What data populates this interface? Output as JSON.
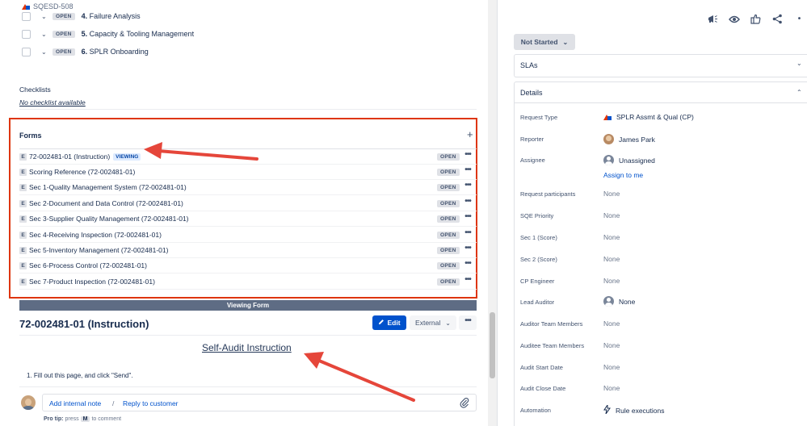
{
  "issue": {
    "key": "SQESD-508"
  },
  "subtasks": [
    {
      "status": "OPEN",
      "number": "4.",
      "title": "Failure Analysis"
    },
    {
      "status": "OPEN",
      "number": "5.",
      "title": "Capacity & Tooling Management"
    },
    {
      "status": "OPEN",
      "number": "6.",
      "title": "SPLR Onboarding"
    }
  ],
  "checklists": {
    "label": "Checklists",
    "empty": "No checklist available"
  },
  "forms": {
    "title": "Forms",
    "add": "+",
    "badge_letter": "E",
    "viewing_label": "VIEWING",
    "rows": [
      {
        "name": "72-002481-01 (Instruction)",
        "status": "OPEN"
      },
      {
        "name": "Scoring Reference (72-002481-01)",
        "status": "OPEN"
      },
      {
        "name": "Sec 1-Quality Management System (72-002481-01)",
        "status": "OPEN"
      },
      {
        "name": "Sec 2-Document and Data Control (72-002481-01)",
        "status": "OPEN"
      },
      {
        "name": "Sec 3-Supplier Quality Management (72-002481-01)",
        "status": "OPEN"
      },
      {
        "name": "Sec 4-Receiving Inspection (72-002481-01)",
        "status": "OPEN"
      },
      {
        "name": "Sec 5-Inventory Management (72-002481-01)",
        "status": "OPEN"
      },
      {
        "name": "Sec 6-Process Control (72-002481-01)",
        "status": "OPEN"
      },
      {
        "name": "Sec 7-Product Inspection (72-002481-01)",
        "status": "OPEN"
      }
    ],
    "more": "•••"
  },
  "viewing_form": {
    "bar_label": "Viewing Form",
    "title": "72-002481-01 (Instruction)",
    "edit_label": "Edit",
    "external_label": "External",
    "more": "•••",
    "heading": "Self-Audit Instruction",
    "instruction": "1. Fill out this page, and click \"Send\"."
  },
  "comment": {
    "add_note": "Add internal note",
    "separator": "/",
    "reply": "Reply to customer",
    "protip_bold": "Pro tip:",
    "protip_press": "press",
    "protip_key": "M",
    "protip_rest": "to comment"
  },
  "sidebar": {
    "status": "Not Started",
    "slas_label": "SLAs",
    "details_label": "Details",
    "fields": [
      {
        "label": "Request Type",
        "value": "SPLR Assmt & Qual (CP)"
      },
      {
        "label": "Reporter",
        "value": "James Park"
      },
      {
        "label": "Assignee",
        "value": "Unassigned"
      },
      {
        "label": "Request participants",
        "value": "None"
      },
      {
        "label": "SQE Priority",
        "value": "None"
      },
      {
        "label": "Sec 1 (Score)",
        "value": "None"
      },
      {
        "label": "Sec 2 (Score)",
        "value": "None"
      },
      {
        "label": "CP Engineer",
        "value": "None"
      },
      {
        "label": "Lead Auditor",
        "value": "None"
      },
      {
        "label": "Auditor Team Members",
        "value": "None"
      },
      {
        "label": "Auditee Team Members",
        "value": "None"
      },
      {
        "label": "Audit Start Date",
        "value": "None"
      },
      {
        "label": "Audit Close Date",
        "value": "None"
      },
      {
        "label": "Automation",
        "value": "Rule executions"
      }
    ],
    "assign_to_me": "Assign to me"
  },
  "icons": {
    "top": [
      "megaphone-icon",
      "eye-icon",
      "thumbs-up-icon",
      "share-icon",
      "more-icon"
    ]
  },
  "colors": {
    "accent": "#0052cc",
    "highlight_box": "#de350b",
    "arrow": "#e5463a"
  }
}
